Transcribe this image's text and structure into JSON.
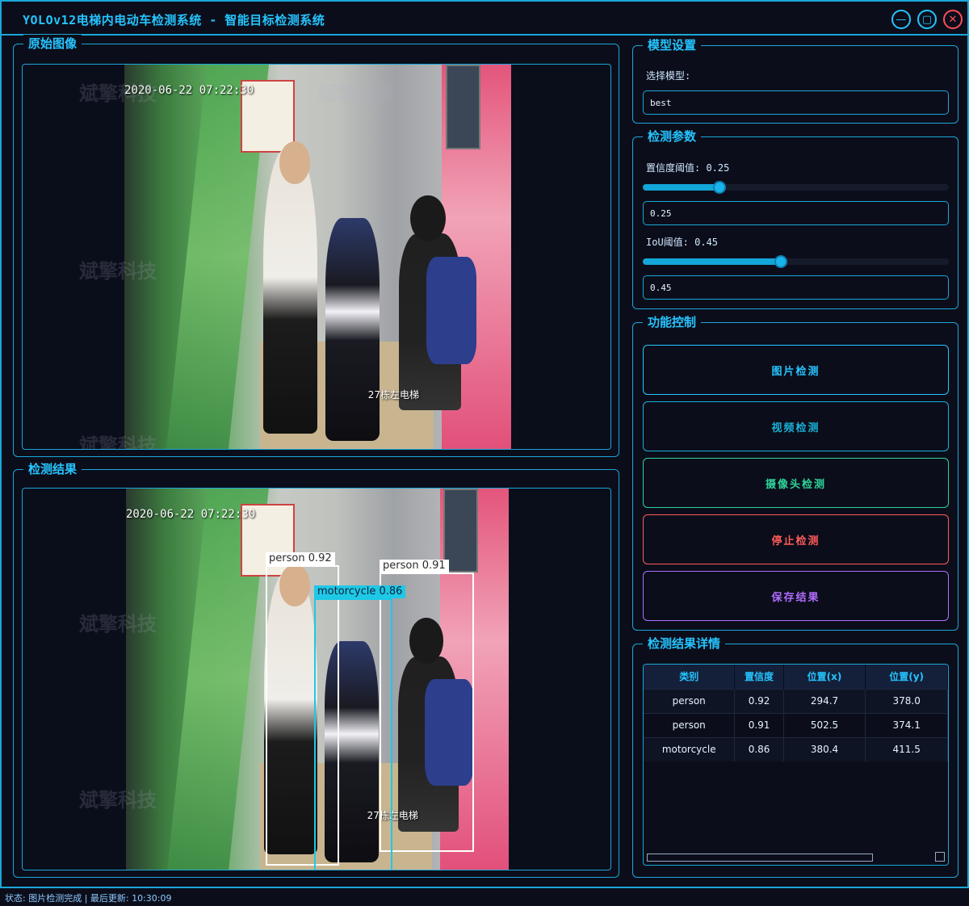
{
  "window": {
    "title": "YOLOv12电梯内电动车检测系统 - 智能目标检测系统",
    "minimize_glyph": "—",
    "maximize_glyph": "▢",
    "close_glyph": "✕"
  },
  "original": {
    "title": "原始图像",
    "timestamp": "2020-06-22 07:22:30",
    "caption": "27栋左电梯"
  },
  "result": {
    "title": "检测结果",
    "timestamp": "2020-06-22 07:22:30",
    "caption": "27栋左电梯",
    "boxes": [
      {
        "label": "person 0.92"
      },
      {
        "label": "person 0.91"
      },
      {
        "label": "motorcycle 0.86"
      }
    ]
  },
  "watermark_text": "斌擎科技",
  "model": {
    "title": "模型设置",
    "select_label": "选择模型:",
    "selected": "best"
  },
  "params": {
    "title": "检测参数",
    "conf_label": "置信度阈值: 0.25",
    "conf_value": "0.25",
    "conf_level": 0.25,
    "iou_label": "IoU阈值: 0.45",
    "iou_value": "0.45",
    "iou_level": 0.45
  },
  "controls": {
    "title": "功能控制",
    "image_detect": "图片检测",
    "video_detect": "视频检测",
    "camera_detect": "摄像头检测",
    "stop_detect": "停止检测",
    "save_result": "保存结果",
    "colors": {
      "image": "#25c4ff",
      "video": "#1ab0d8",
      "camera": "#2fd39a",
      "stop": "#ff5a5a",
      "save": "#b06cff"
    }
  },
  "details": {
    "title": "检测结果详情",
    "columns": [
      "类别",
      "置信度",
      "位置(x)",
      "位置(y)"
    ],
    "rows": [
      [
        "person",
        "0.92",
        "294.7",
        "378.0"
      ],
      [
        "person",
        "0.91",
        "502.5",
        "374.1"
      ],
      [
        "motorcycle",
        "0.86",
        "380.4",
        "411.5"
      ]
    ]
  },
  "status": "状态: 图片检测完成 | 最后更新: 10:30:09"
}
